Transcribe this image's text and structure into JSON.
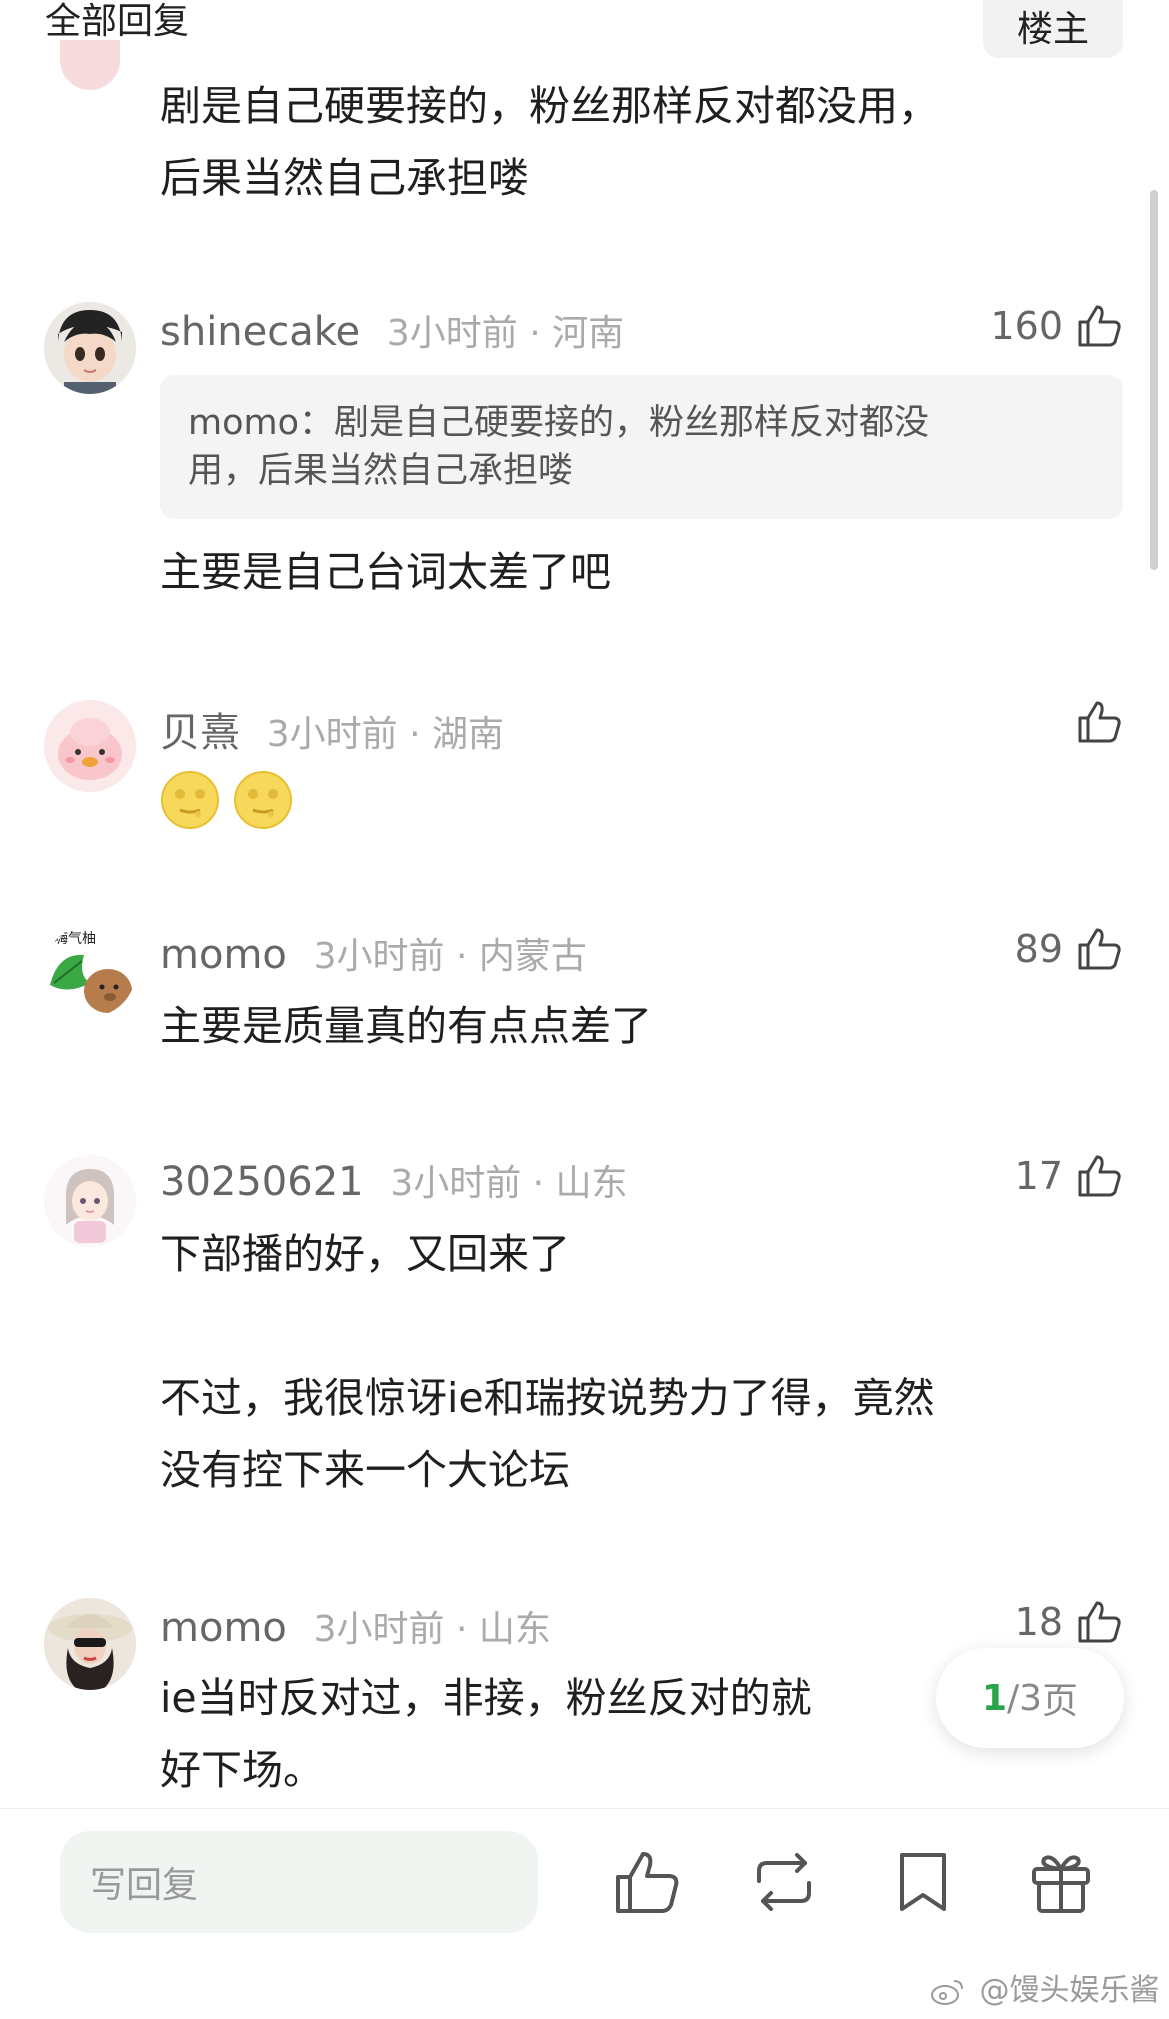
{
  "header": {
    "title": "全部回复",
    "owner_label": "楼主"
  },
  "main_post": {
    "text_line1": "剧是自己硬要接的，粉丝那样反对都没用，",
    "text_line2": "后果当然自己承担喽"
  },
  "replies": [
    {
      "username": "shinecake",
      "meta": "3小时前 · 河南",
      "likes": "160",
      "quote_line1": "momo：剧是自己硬要接的，粉丝那样反对都没",
      "quote_line2": "用，后果当然自己承担喽",
      "text": "主要是自己台词太差了吧"
    },
    {
      "username": "贝熹",
      "meta": "3小时前 · 湖南",
      "likes": "",
      "emojis": [
        "moon-face-icon",
        "moon-face-icon"
      ]
    },
    {
      "username": "momo",
      "meta": "3小时前 · 内蒙古",
      "likes": "89",
      "text": "主要是质量真的有点点差了"
    },
    {
      "username": "30250621",
      "meta": "3小时前 · 山东",
      "likes": "17",
      "text_line1": "下部播的好，又回来了",
      "text_line2": "不过，我很惊讶ie和瑞按说势力了得，竟然",
      "text_line3": "没有控下来一个大论坛"
    },
    {
      "username": "momo",
      "meta": "3小时前 · 山东",
      "likes": "18",
      "text_line1": "ie当时反对过，非接，粉丝反对的就",
      "text_line2": "好下场。"
    }
  ],
  "pager": {
    "current": "1",
    "total": "/3",
    "suffix": " 页"
  },
  "bottom_bar": {
    "reply_placeholder": "写回复",
    "icons": [
      "thumbs-up-icon",
      "repost-icon",
      "bookmark-icon",
      "gift-icon"
    ]
  },
  "watermark": "@馒头娱乐酱",
  "colors": {
    "accent": "#2aa44a",
    "meta_gray": "#aaaaaa",
    "quote_bg": "#f4f4f4"
  }
}
